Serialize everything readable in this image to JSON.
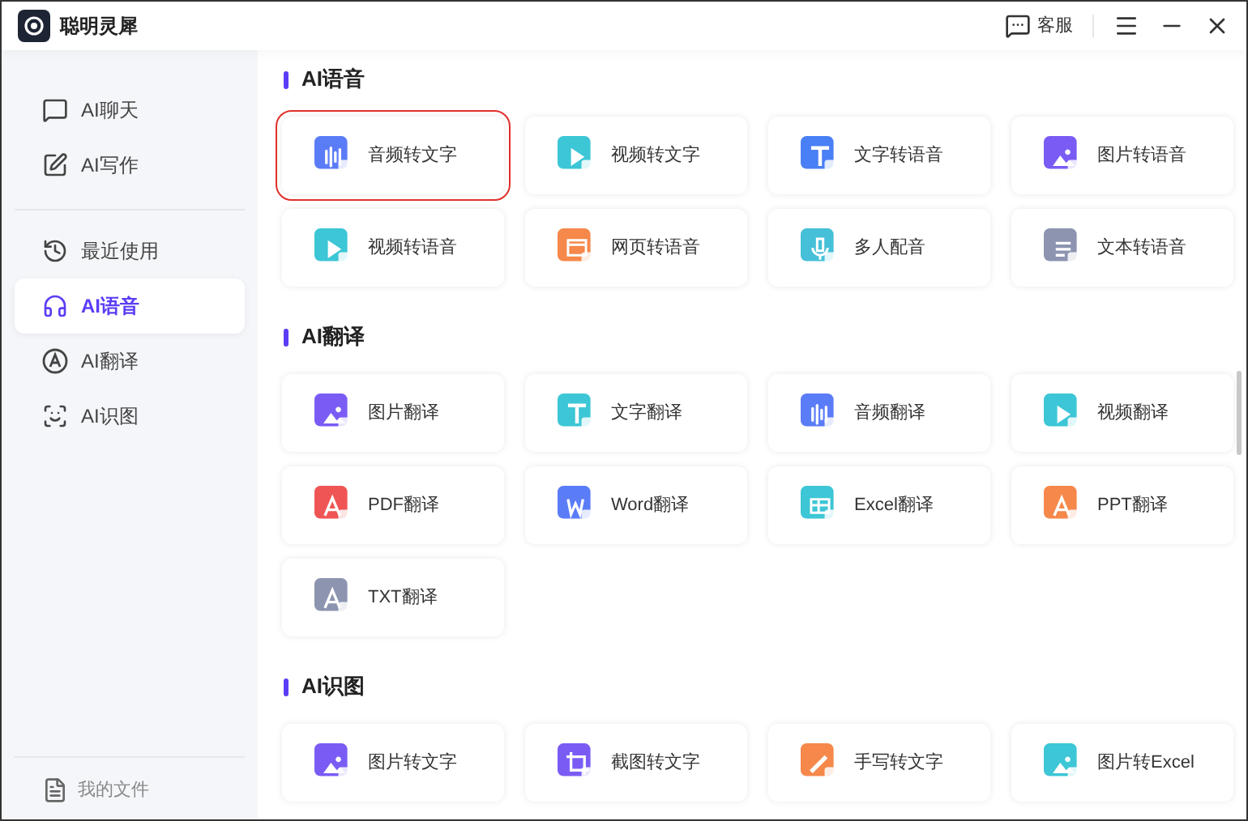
{
  "window": {
    "title": "聪明灵犀"
  },
  "header": {
    "support": "客服"
  },
  "sidebar": {
    "groups": [
      {
        "items": [
          {
            "label": "AI聊天",
            "kind": "chat",
            "selected": false
          },
          {
            "label": "AI写作",
            "kind": "write",
            "selected": false
          }
        ]
      },
      {
        "items": [
          {
            "label": "最近使用",
            "kind": "history",
            "selected": false
          },
          {
            "label": "AI语音",
            "kind": "voice",
            "selected": true
          },
          {
            "label": "AI翻译",
            "kind": "translate",
            "selected": false
          },
          {
            "label": "AI识图",
            "kind": "scan",
            "selected": false
          }
        ]
      }
    ],
    "footer": "我的文件"
  },
  "sections": [
    {
      "title": "AI语音",
      "tools": [
        {
          "label": "音频转文字",
          "color": "#5b7cf7",
          "kind": "audio",
          "highlighted": true
        },
        {
          "label": "视频转文字",
          "color": "#3cc6d6",
          "kind": "video",
          "highlighted": false
        },
        {
          "label": "文字转语音",
          "color": "#4a80f5",
          "kind": "text",
          "highlighted": false
        },
        {
          "label": "图片转语音",
          "color": "#7a5cf5",
          "kind": "image",
          "highlighted": false
        },
        {
          "label": "视频转语音",
          "color": "#3cc6d6",
          "kind": "video",
          "highlighted": false
        },
        {
          "label": "网页转语音",
          "color": "#f5884a",
          "kind": "web",
          "highlighted": false
        },
        {
          "label": "多人配音",
          "color": "#45c0d8",
          "kind": "mic",
          "highlighted": false
        },
        {
          "label": "文本转语音",
          "color": "#8c94b0",
          "kind": "doc",
          "highlighted": false
        }
      ]
    },
    {
      "title": "AI翻译",
      "tools": [
        {
          "label": "图片翻译",
          "color": "#7a5cf5",
          "kind": "image",
          "highlighted": false
        },
        {
          "label": "文字翻译",
          "color": "#3cc6d6",
          "kind": "text",
          "highlighted": false
        },
        {
          "label": "音频翻译",
          "color": "#5b7cf7",
          "kind": "audio",
          "highlighted": false
        },
        {
          "label": "视频翻译",
          "color": "#3cc6d6",
          "kind": "video",
          "highlighted": false
        },
        {
          "label": "PDF翻译",
          "color": "#f05555",
          "kind": "pdf",
          "highlighted": false
        },
        {
          "label": "Word翻译",
          "color": "#5b7cf7",
          "kind": "word",
          "highlighted": false
        },
        {
          "label": "Excel翻译",
          "color": "#3cc6d6",
          "kind": "excel",
          "highlighted": false
        },
        {
          "label": "PPT翻译",
          "color": "#f5884a",
          "kind": "pdf",
          "highlighted": false
        },
        {
          "label": "TXT翻译",
          "color": "#8c94b0",
          "kind": "pdf",
          "highlighted": false
        }
      ]
    },
    {
      "title": "AI识图",
      "tools": [
        {
          "label": "图片转文字",
          "color": "#7a5cf5",
          "kind": "image",
          "highlighted": false
        },
        {
          "label": "截图转文字",
          "color": "#7a5cf5",
          "kind": "crop",
          "highlighted": false
        },
        {
          "label": "手写转文字",
          "color": "#f5884a",
          "kind": "pen",
          "highlighted": false
        },
        {
          "label": "图片转Excel",
          "color": "#3cc6d6",
          "kind": "image",
          "highlighted": false
        }
      ]
    }
  ]
}
